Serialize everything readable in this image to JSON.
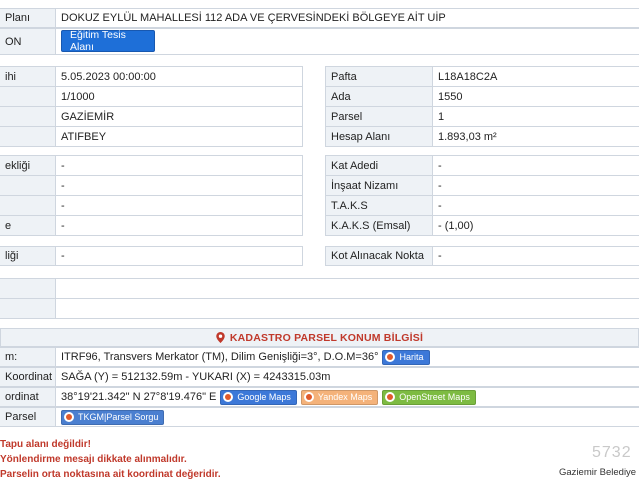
{
  "top": {
    "plan_label": "Planı",
    "plan_value": "DOKUZ EYLÜL MAHALLESİ 112 ADA VE ÇERVESİNDEKİ BÖLGEYE AİT UİP",
    "fon_label": "ON",
    "fon_button": "Eğitim Tesis Alanı"
  },
  "left_block1": {
    "labels": [
      "ihi",
      "",
      "",
      ""
    ],
    "values": [
      "5.05.2023 00:00:00",
      "1/1000",
      "GAZİEMİR",
      "ATIFBEY"
    ]
  },
  "right_block1": {
    "labels": [
      "Pafta",
      "Ada",
      "Parsel",
      "Hesap Alanı"
    ],
    "values": [
      "L18A18C2A",
      "1550",
      "1",
      "1.893,03 m²"
    ]
  },
  "left_block2": {
    "labels": [
      "ekliği",
      "",
      "",
      "e"
    ],
    "values": [
      "-",
      "-",
      "-",
      "-"
    ]
  },
  "right_block2": {
    "labels": [
      "Kat Adedi",
      "İnşaat Nizamı",
      "T.A.K.S",
      "K.A.K.S (Emsal)"
    ],
    "values": [
      "-",
      "-",
      "-",
      "- (1,00)"
    ]
  },
  "left_block3": {
    "label": "liği",
    "value": "-"
  },
  "right_block3": {
    "label": "Kot Alınacak Nokta",
    "value": "-"
  },
  "kadastro": {
    "title": "KADASTRO PARSEL KONUM BİLGİSİ",
    "rows": [
      {
        "label": "m:",
        "value": "ITRF96, Transvers Merkator (TM), Dilim Genişliği=3°, D.O.M=36°"
      },
      {
        "label": "Koordinat",
        "value": "SAĞA (Y) = 512132.59m - YUKARI (X) = 4243315.03m"
      },
      {
        "label": "ordinat",
        "value": "38°19'21.342\" N 27°8'19.476\" E"
      },
      {
        "label": "Parsel",
        "value": ""
      }
    ],
    "harita_btn": "Harita",
    "google_btn": "Google Maps",
    "yandex_btn": "Yandex Maps",
    "osm_btn": "OpenStreet Maps",
    "tkgm_btn": "TKGM|Parsel Sorgu"
  },
  "warnings": [
    "Tapu alanı değildir!",
    "Yönlendirme mesajı dikkate alınmalıdır.",
    "Parselin orta noktasına ait koordinat değeridir."
  ],
  "footer": {
    "watermark": "5732",
    "municipality": "Gaziemir Belediye"
  },
  "colors": {
    "accent_blue": "#1e6fd8",
    "warning_red": "#c0392b",
    "google": "#3c78d8",
    "yandex": "#f4b27a",
    "osm": "#7dbb42",
    "tkgm": "#4a7fd0",
    "harita": "#3c78d8"
  }
}
